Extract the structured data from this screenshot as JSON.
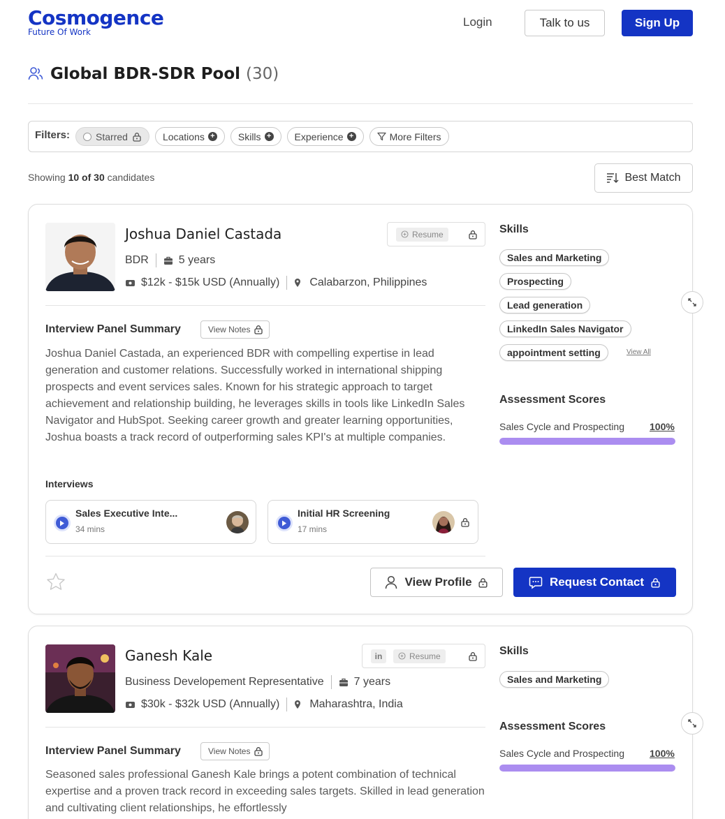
{
  "header": {
    "logo_name": "Cosmogence",
    "logo_tagline": "Future Of Work",
    "login_label": "Login",
    "talk_label": "Talk to us",
    "signup_label": "Sign Up"
  },
  "page": {
    "title": "Global BDR-SDR Pool",
    "count": "(30)"
  },
  "filters": {
    "label": "Filters:",
    "chips": [
      "Starred",
      "Locations",
      "Skills",
      "Experience",
      "More Filters"
    ]
  },
  "results": {
    "showing_prefix": "Showing",
    "showing_range": "10 of 30",
    "showing_suffix": "candidates",
    "sort_label": "Best Match"
  },
  "candidates": [
    {
      "name": "Joshua Daniel Castada",
      "resume_label": "Resume",
      "role": "BDR",
      "experience": "5 years",
      "salary": "$12k - $15k USD (Annually)",
      "location": "Calabarzon, Philippines",
      "summary_title": "Interview Panel Summary",
      "view_notes_label": "View Notes",
      "summary": "Joshua Daniel Castada, an experienced BDR with compelling expertise in lead generation and customer relations. Successfully worked in international shipping prospects and event services sales. Known for his strategic approach to target achievement and relationship building, he leverages skills in tools like LinkedIn Sales Navigator and HubSpot. Seeking career growth and greater learning opportunities, Joshua boasts a track record of outperforming sales KPI's at multiple companies.",
      "interviews_title": "Interviews",
      "interviews": [
        {
          "title": "Sales Executive Inte...",
          "duration": "34 mins"
        },
        {
          "title": "Initial HR Screening",
          "duration": "17 mins"
        }
      ],
      "view_profile_label": "View Profile",
      "request_contact_label": "Request Contact",
      "skills_title": "Skills",
      "skills": [
        "Sales and Marketing",
        "Prospecting",
        "Lead generation",
        "LinkedIn Sales Navigator",
        "appointment setting"
      ],
      "view_all_label": "View All",
      "assessment_title": "Assessment Scores",
      "scores": [
        {
          "label": "Sales Cycle and Prospecting",
          "value": "100%",
          "fraction": 1.0
        }
      ]
    },
    {
      "name": "Ganesh Kale",
      "linkedin_label": "in",
      "resume_label": "Resume",
      "role": "Business Developement Representative",
      "experience": "7 years",
      "salary": "$30k - $32k USD (Annually)",
      "location": "Maharashtra, India",
      "summary_title": "Interview Panel Summary",
      "view_notes_label": "View Notes",
      "summary": "Seasoned sales professional Ganesh Kale brings a potent combination of technical expertise and a proven track record in exceeding sales targets. Skilled in lead generation and cultivating client relationships, he effortlessly",
      "skills_title": "Skills",
      "skills": [
        "Sales and Marketing"
      ],
      "assessment_title": "Assessment Scores",
      "scores": [
        {
          "label": "Sales Cycle and Prospecting",
          "value": "100%",
          "fraction": 1.0
        }
      ]
    }
  ],
  "colors": {
    "brand": "#1434c4",
    "score_fill": "#ab8df0"
  }
}
